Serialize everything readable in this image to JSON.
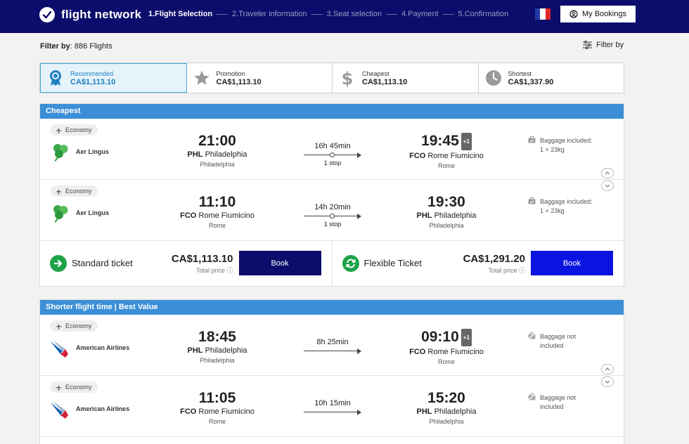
{
  "header": {
    "logo_text": "flight network",
    "steps": [
      "1.Flight Selection",
      "2.Traveler information",
      "3.Seat selection",
      "4.Payment",
      "5.Confirmation"
    ],
    "active_step": 0,
    "language_icon": "french-flag-icon",
    "my_bookings_label": "My Bookings"
  },
  "filter": {
    "label": "Filter by",
    "count_text": ": 886 Flights",
    "button_label": "Filter by"
  },
  "sort_tabs": [
    {
      "label": "Recommended",
      "price": "CA$1,113.10",
      "icon": "award-icon",
      "active": true
    },
    {
      "label": "Promotion",
      "price": "CA$1,113.10",
      "icon": "star-icon",
      "active": false
    },
    {
      "label": "Cheapest",
      "price": "CA$1,113.10",
      "icon": "dollar-icon",
      "active": false
    },
    {
      "label": "Shortest",
      "price": "CA$1,337.90",
      "icon": "clock-icon",
      "active": false
    }
  ],
  "groups": [
    {
      "title": "Cheapest",
      "flights": [
        {
          "cabin": "Economy",
          "airline": "Aer Lingus",
          "dep_time": "21:00",
          "dep_code": "PHL",
          "dep_airport": "Philadelphia",
          "dep_city": "Philadelphia",
          "duration": "16h 45min",
          "stops": "1 stop",
          "arr_time": "19:45",
          "plus_day": "+1",
          "arr_code": "FCO",
          "arr_airport": "Rome Fiumicino",
          "arr_city": "Rome",
          "baggage_line1": "Baggage included:",
          "baggage_line2": "1 × 23kg"
        },
        {
          "cabin": "Economy",
          "airline": "Aer Lingus",
          "dep_time": "11:10",
          "dep_code": "FCO",
          "dep_airport": "Rome Fiumicino",
          "dep_city": "Rome",
          "duration": "14h 20min",
          "stops": "1 stop",
          "arr_time": "19:30",
          "plus_day": "",
          "arr_code": "PHL",
          "arr_airport": "Philadelphia",
          "arr_city": "Philadelphia",
          "baggage_line1": "Baggage included:",
          "baggage_line2": "1 × 23kg"
        }
      ],
      "tickets": [
        {
          "name": "Standard ticket",
          "price": "CA$1,113.10",
          "price_label": "Total price",
          "book_label": "Book",
          "button_color": "#0b0c6b"
        },
        {
          "name": "Flexible Ticket",
          "price": "CA$1,291.20",
          "price_label": "Total price",
          "book_label": "Book",
          "button_color": "#0a14e0"
        }
      ]
    },
    {
      "title": "Shorter flight time | Best Value",
      "flights": [
        {
          "cabin": "Economy",
          "airline": "American Airlines",
          "dep_time": "18:45",
          "dep_code": "PHL",
          "dep_airport": "Philadelphia",
          "dep_city": "Philadelphia",
          "duration": "8h 25min",
          "stops": "",
          "arr_time": "09:10",
          "plus_day": "+1",
          "arr_code": "FCO",
          "arr_airport": "Rome Fiumicino",
          "arr_city": "Rome",
          "baggage_line1": "Baggage not",
          "baggage_line2": "included"
        },
        {
          "cabin": "Economy",
          "airline": "American Airlines",
          "dep_time": "11:05",
          "dep_code": "FCO",
          "dep_airport": "Rome Fiumicino",
          "dep_city": "Rome",
          "duration": "10h 15min",
          "stops": "",
          "arr_time": "15:20",
          "plus_day": "",
          "arr_code": "PHL",
          "arr_airport": "Philadelphia",
          "arr_city": "Philadelphia",
          "baggage_line1": "Baggage not",
          "baggage_line2": "included"
        }
      ]
    }
  ],
  "colors": {
    "header_bg": "#0b0c6b",
    "group_head_bg": "#3b8fd6",
    "active_tab_text": "#1f7fc0",
    "ticket_icon_green": "#1fa34a"
  }
}
